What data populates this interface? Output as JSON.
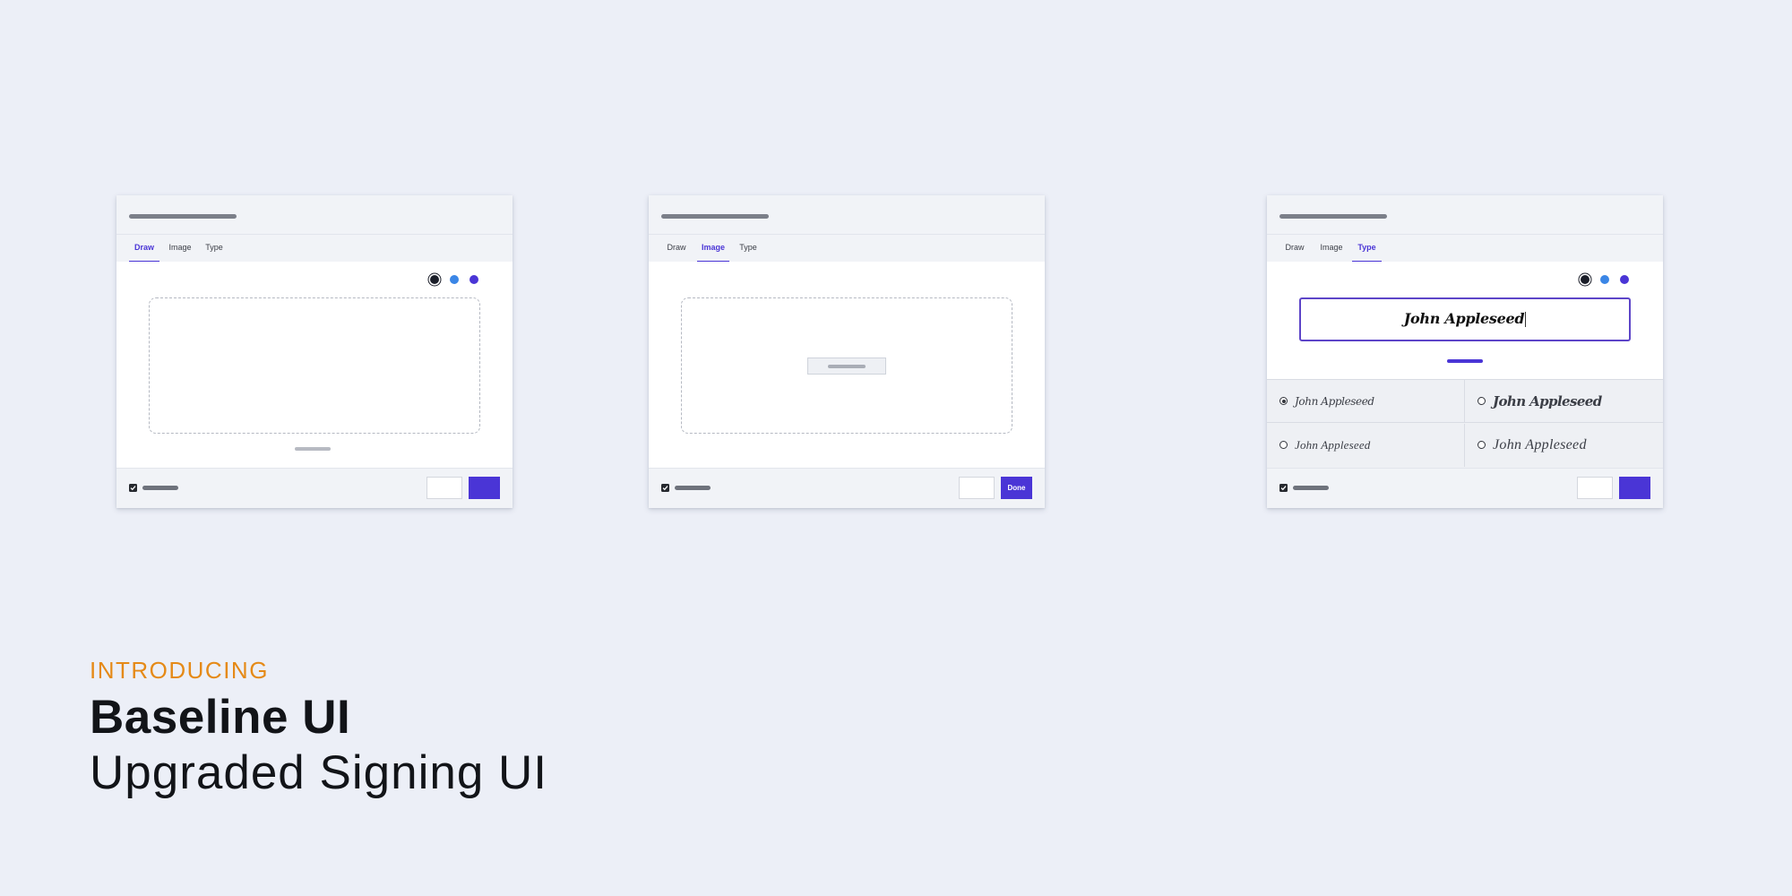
{
  "colors": {
    "accent": "#4a35d6",
    "background": "#eceff7",
    "kicker": "#e58a17",
    "swatches": [
      "#1a1d28",
      "#3b86e6",
      "#4a35d6"
    ]
  },
  "tabs": [
    "Draw",
    "Image",
    "Type"
  ],
  "cards": {
    "draw": {
      "active_tab": "Draw",
      "primary_label": ""
    },
    "image": {
      "active_tab": "Image",
      "primary_label": "Done"
    },
    "type": {
      "active_tab": "Type",
      "primary_label": "",
      "typed_name": "John Appleseed",
      "font_options": [
        {
          "label": "John Appleseed",
          "selected": true
        },
        {
          "label": "John Appleseed",
          "selected": false
        },
        {
          "label": "John Appleseed",
          "selected": false
        },
        {
          "label": "John Appleseed",
          "selected": false
        }
      ]
    }
  },
  "hero": {
    "kicker": "INTRODUCING",
    "title": "Baseline UI",
    "subtitle": "Upgraded Signing UI"
  }
}
